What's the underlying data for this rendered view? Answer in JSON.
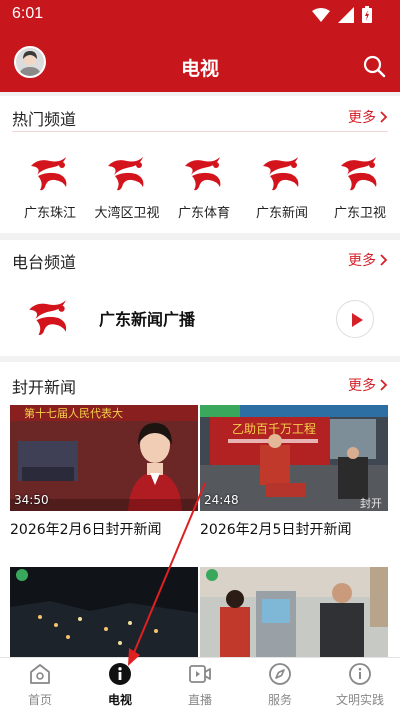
{
  "status_bar": {
    "time": "6:01"
  },
  "header": {
    "title": "电视"
  },
  "hot_channels": {
    "title": "热门频道",
    "more": "更多",
    "items": [
      {
        "label": "广东珠江"
      },
      {
        "label": "大湾区卫视"
      },
      {
        "label": "广东体育"
      },
      {
        "label": "广东新闻"
      },
      {
        "label": "广东卫视"
      }
    ]
  },
  "radio_channels": {
    "title": "电台频道",
    "more": "更多",
    "item": {
      "name": "广东新闻广播"
    }
  },
  "news": {
    "title": "封开新闻",
    "more": "更多",
    "items": [
      {
        "duration": "34:50",
        "caption": "2026年2月6日封开新闻"
      },
      {
        "duration": "24:48",
        "caption": "2026年2月5日封开新闻"
      },
      {
        "duration": "",
        "caption": ""
      },
      {
        "duration": "",
        "caption": ""
      }
    ]
  },
  "tabbar": {
    "items": [
      {
        "label": "首页"
      },
      {
        "label": "电视"
      },
      {
        "label": "直播"
      },
      {
        "label": "服务"
      },
      {
        "label": "文明实践"
      }
    ],
    "active": "电视"
  },
  "colors": {
    "brand": "#c8161d",
    "accent": "#d4222a",
    "divider": "#f2f2f2"
  },
  "icons": {
    "search": "search-icon",
    "channel_logo": "guangdong-tv-logo-icon",
    "play": "play-icon",
    "tabs": [
      "home-icon",
      "info-icon",
      "video-live-icon",
      "compass-icon",
      "info-icon"
    ]
  }
}
